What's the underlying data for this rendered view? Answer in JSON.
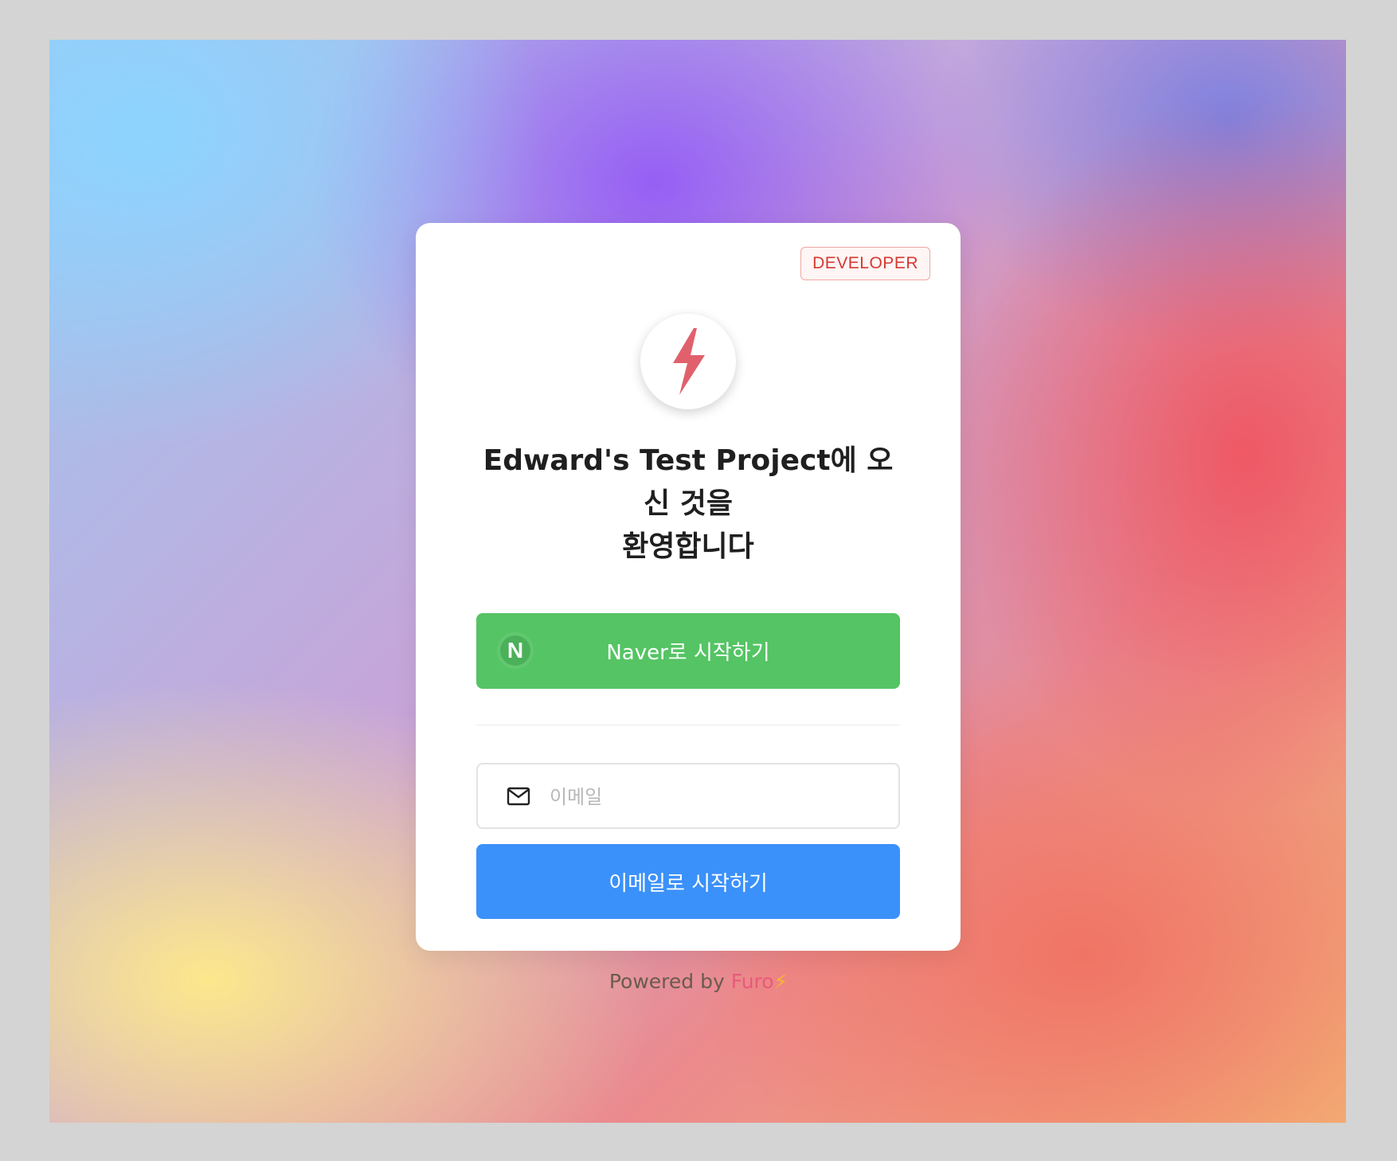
{
  "badge": {
    "label": "DEVELOPER"
  },
  "logo": {
    "icon": "lightning-bolt-icon",
    "color": "#e0616c"
  },
  "welcome": {
    "line1": "Edward's Test Project에 오",
    "line2": "신 것을",
    "line3": "환영합니다"
  },
  "naver": {
    "label": "Naver로 시작하기",
    "icon_letter": "N",
    "color": "#55c464"
  },
  "email": {
    "placeholder": "이메일",
    "value": "",
    "icon": "mail-icon"
  },
  "email_button": {
    "label": "이메일로 시작하기",
    "color": "#3b91fa"
  },
  "footer": {
    "prefix": "Powered by ",
    "brand": "Furo",
    "brand_color": "#e85a7a",
    "bolt": "⚡"
  }
}
